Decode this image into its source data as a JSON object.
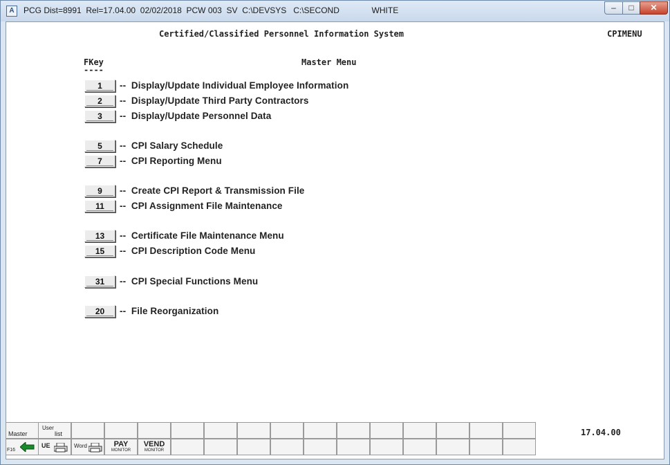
{
  "window": {
    "title": "PCG Dist=8991  Rel=17.04.00  02/02/2018  PCW 003  SV  C:\\DEVSYS   C:\\SECOND              WHITE",
    "icon_letter": "A"
  },
  "header": {
    "system_title": "Certified/Classified Personnel Information System",
    "menu_code": "CPIMENU"
  },
  "menu": {
    "fkey_heading": "FKey",
    "fkey_underline": "----",
    "title": "Master Menu",
    "items": [
      {
        "key": "1",
        "label": "--  Display/Update Individual Employee Information"
      },
      {
        "key": "2",
        "label": "--  Display/Update Third Party Contractors"
      },
      {
        "key": "3",
        "label": "--  Display/Update Personnel Data"
      },
      {
        "key": "5",
        "label": "--  CPI Salary Schedule"
      },
      {
        "key": "7",
        "label": "--  CPI Reporting Menu"
      },
      {
        "key": "9",
        "label": "--  Create CPI Report & Transmission File"
      },
      {
        "key": "11",
        "label": "--  CPI Assignment File Maintenance"
      },
      {
        "key": "13",
        "label": "--  Certificate File Maintenance Menu"
      },
      {
        "key": "15",
        "label": "--  CPI Description Code Menu"
      },
      {
        "key": "31",
        "label": "--  CPI Special Functions Menu"
      },
      {
        "key": "20",
        "label": "--  File Reorganization"
      }
    ]
  },
  "version": "17.04.00",
  "function_bar": {
    "master_label": "Master",
    "userlist_label": "User",
    "userlist_sub": "list",
    "f16_label": "F16",
    "pay_label": "PAY",
    "pay_sub": "MONITOR",
    "vend_label": "VEND",
    "vend_sub": "MONITOR",
    "word_label": "Word",
    "ue_label": "UE"
  },
  "colors": {
    "window_frame": "#dbe6f3",
    "close_button": "#c7442e"
  }
}
